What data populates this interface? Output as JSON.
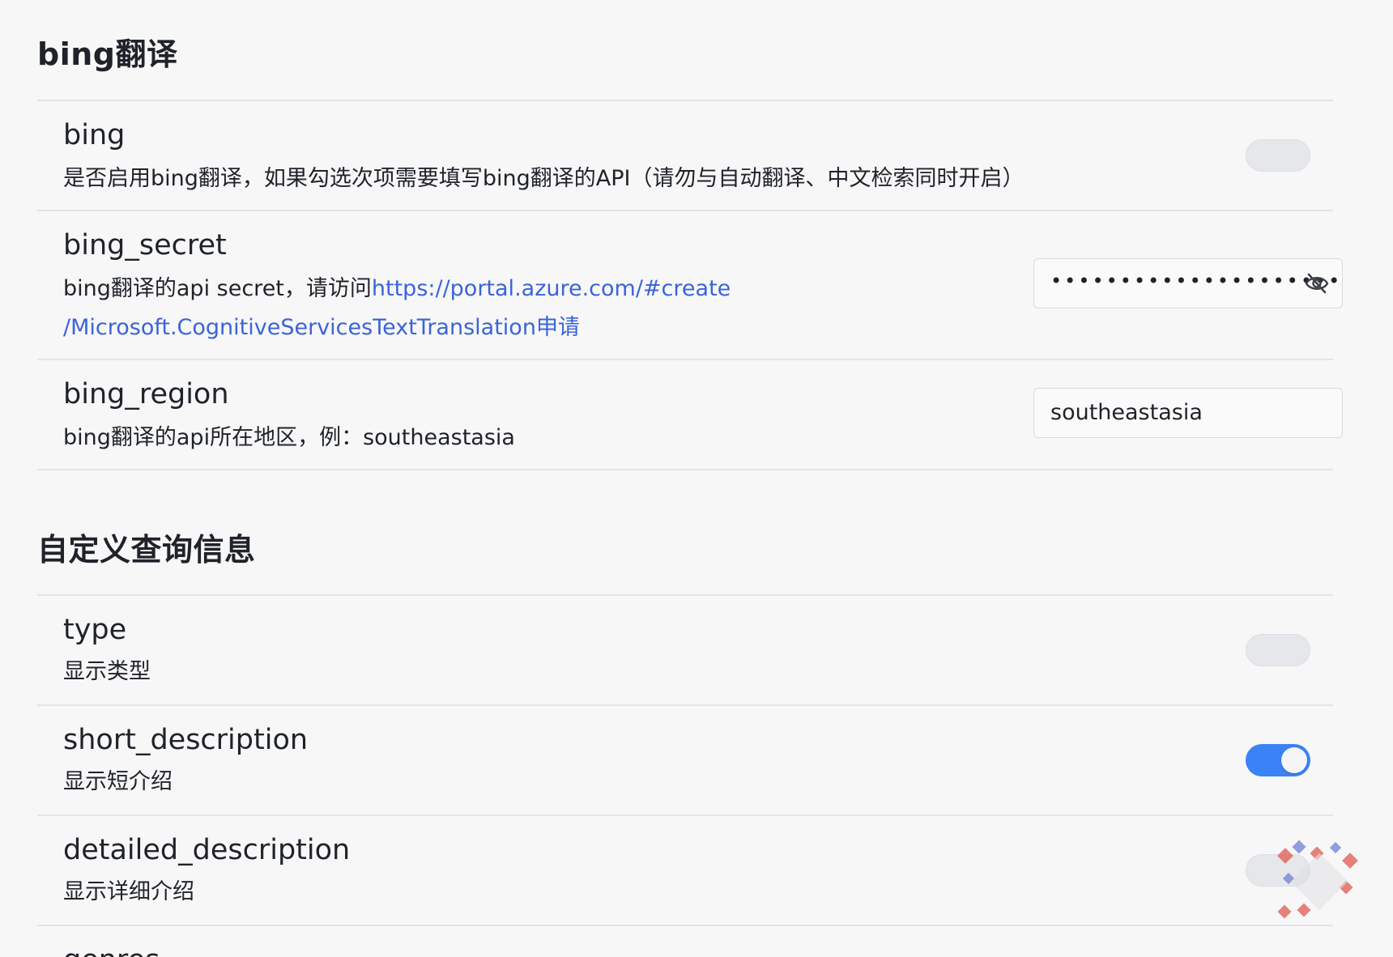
{
  "sections": [
    {
      "title": "bing翻译",
      "items": [
        {
          "name": "bing",
          "desc": "是否启用bing翻译，如果勾选次项需要填写bing翻译的API（请勿与自动翻译、中文检索同时开启）",
          "control": "toggle",
          "enabled": false
        },
        {
          "name": "bing_secret",
          "desc_prefix": "bing翻译的api secret，请访问",
          "desc_link_line1": "https://portal.azure.com/#create",
          "desc_link_line2": "/Microsoft.CognitiveServicesTextTranslation",
          "desc_suffix": "申请",
          "control": "password",
          "value_masked": "•••••••••••••••••••••",
          "icon": "eye-slash-icon"
        },
        {
          "name": "bing_region",
          "desc": "bing翻译的api所在地区，例：southeastasia",
          "control": "text",
          "value": "southeastasia"
        }
      ]
    },
    {
      "title": "自定义查询信息",
      "items": [
        {
          "name": "type",
          "desc": "显示类型",
          "control": "toggle",
          "enabled": false
        },
        {
          "name": "short_description",
          "desc": "显示短介绍",
          "control": "toggle",
          "enabled": true
        },
        {
          "name": "detailed_description",
          "desc": "显示详细介绍",
          "control": "toggle",
          "enabled": false
        },
        {
          "name": "genres",
          "desc": "",
          "control": "toggle"
        }
      ]
    }
  ],
  "colors": {
    "accent": "#3a82f6",
    "link": "#3a64d8",
    "background": "#f7f7f8",
    "divider": "#e3e4e7"
  }
}
